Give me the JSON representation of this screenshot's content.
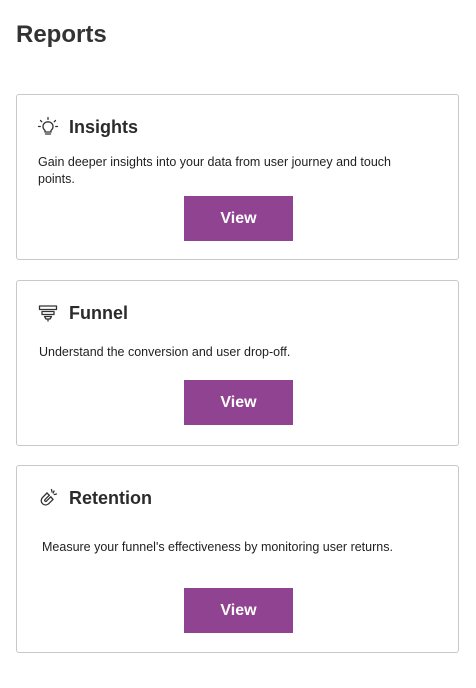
{
  "page": {
    "title": "Reports"
  },
  "cards": [
    {
      "id": "insights",
      "title": "Insights",
      "icon": "lightbulb-icon",
      "description": "Gain deeper insights into your data from user journey and touch points.",
      "button_label": "View"
    },
    {
      "id": "funnel",
      "title": "Funnel",
      "icon": "funnel-icon",
      "description": "Understand the conversion and user drop-off.",
      "button_label": "View"
    },
    {
      "id": "retention",
      "title": "Retention",
      "icon": "magnet-icon",
      "description": "Measure your funnel's effectiveness by monitoring user returns.",
      "button_label": "View"
    }
  ],
  "colors": {
    "button_background": "#8f4390",
    "button_text": "#ffffff",
    "card_border": "#c8c8c8",
    "title_text": "#333333"
  }
}
